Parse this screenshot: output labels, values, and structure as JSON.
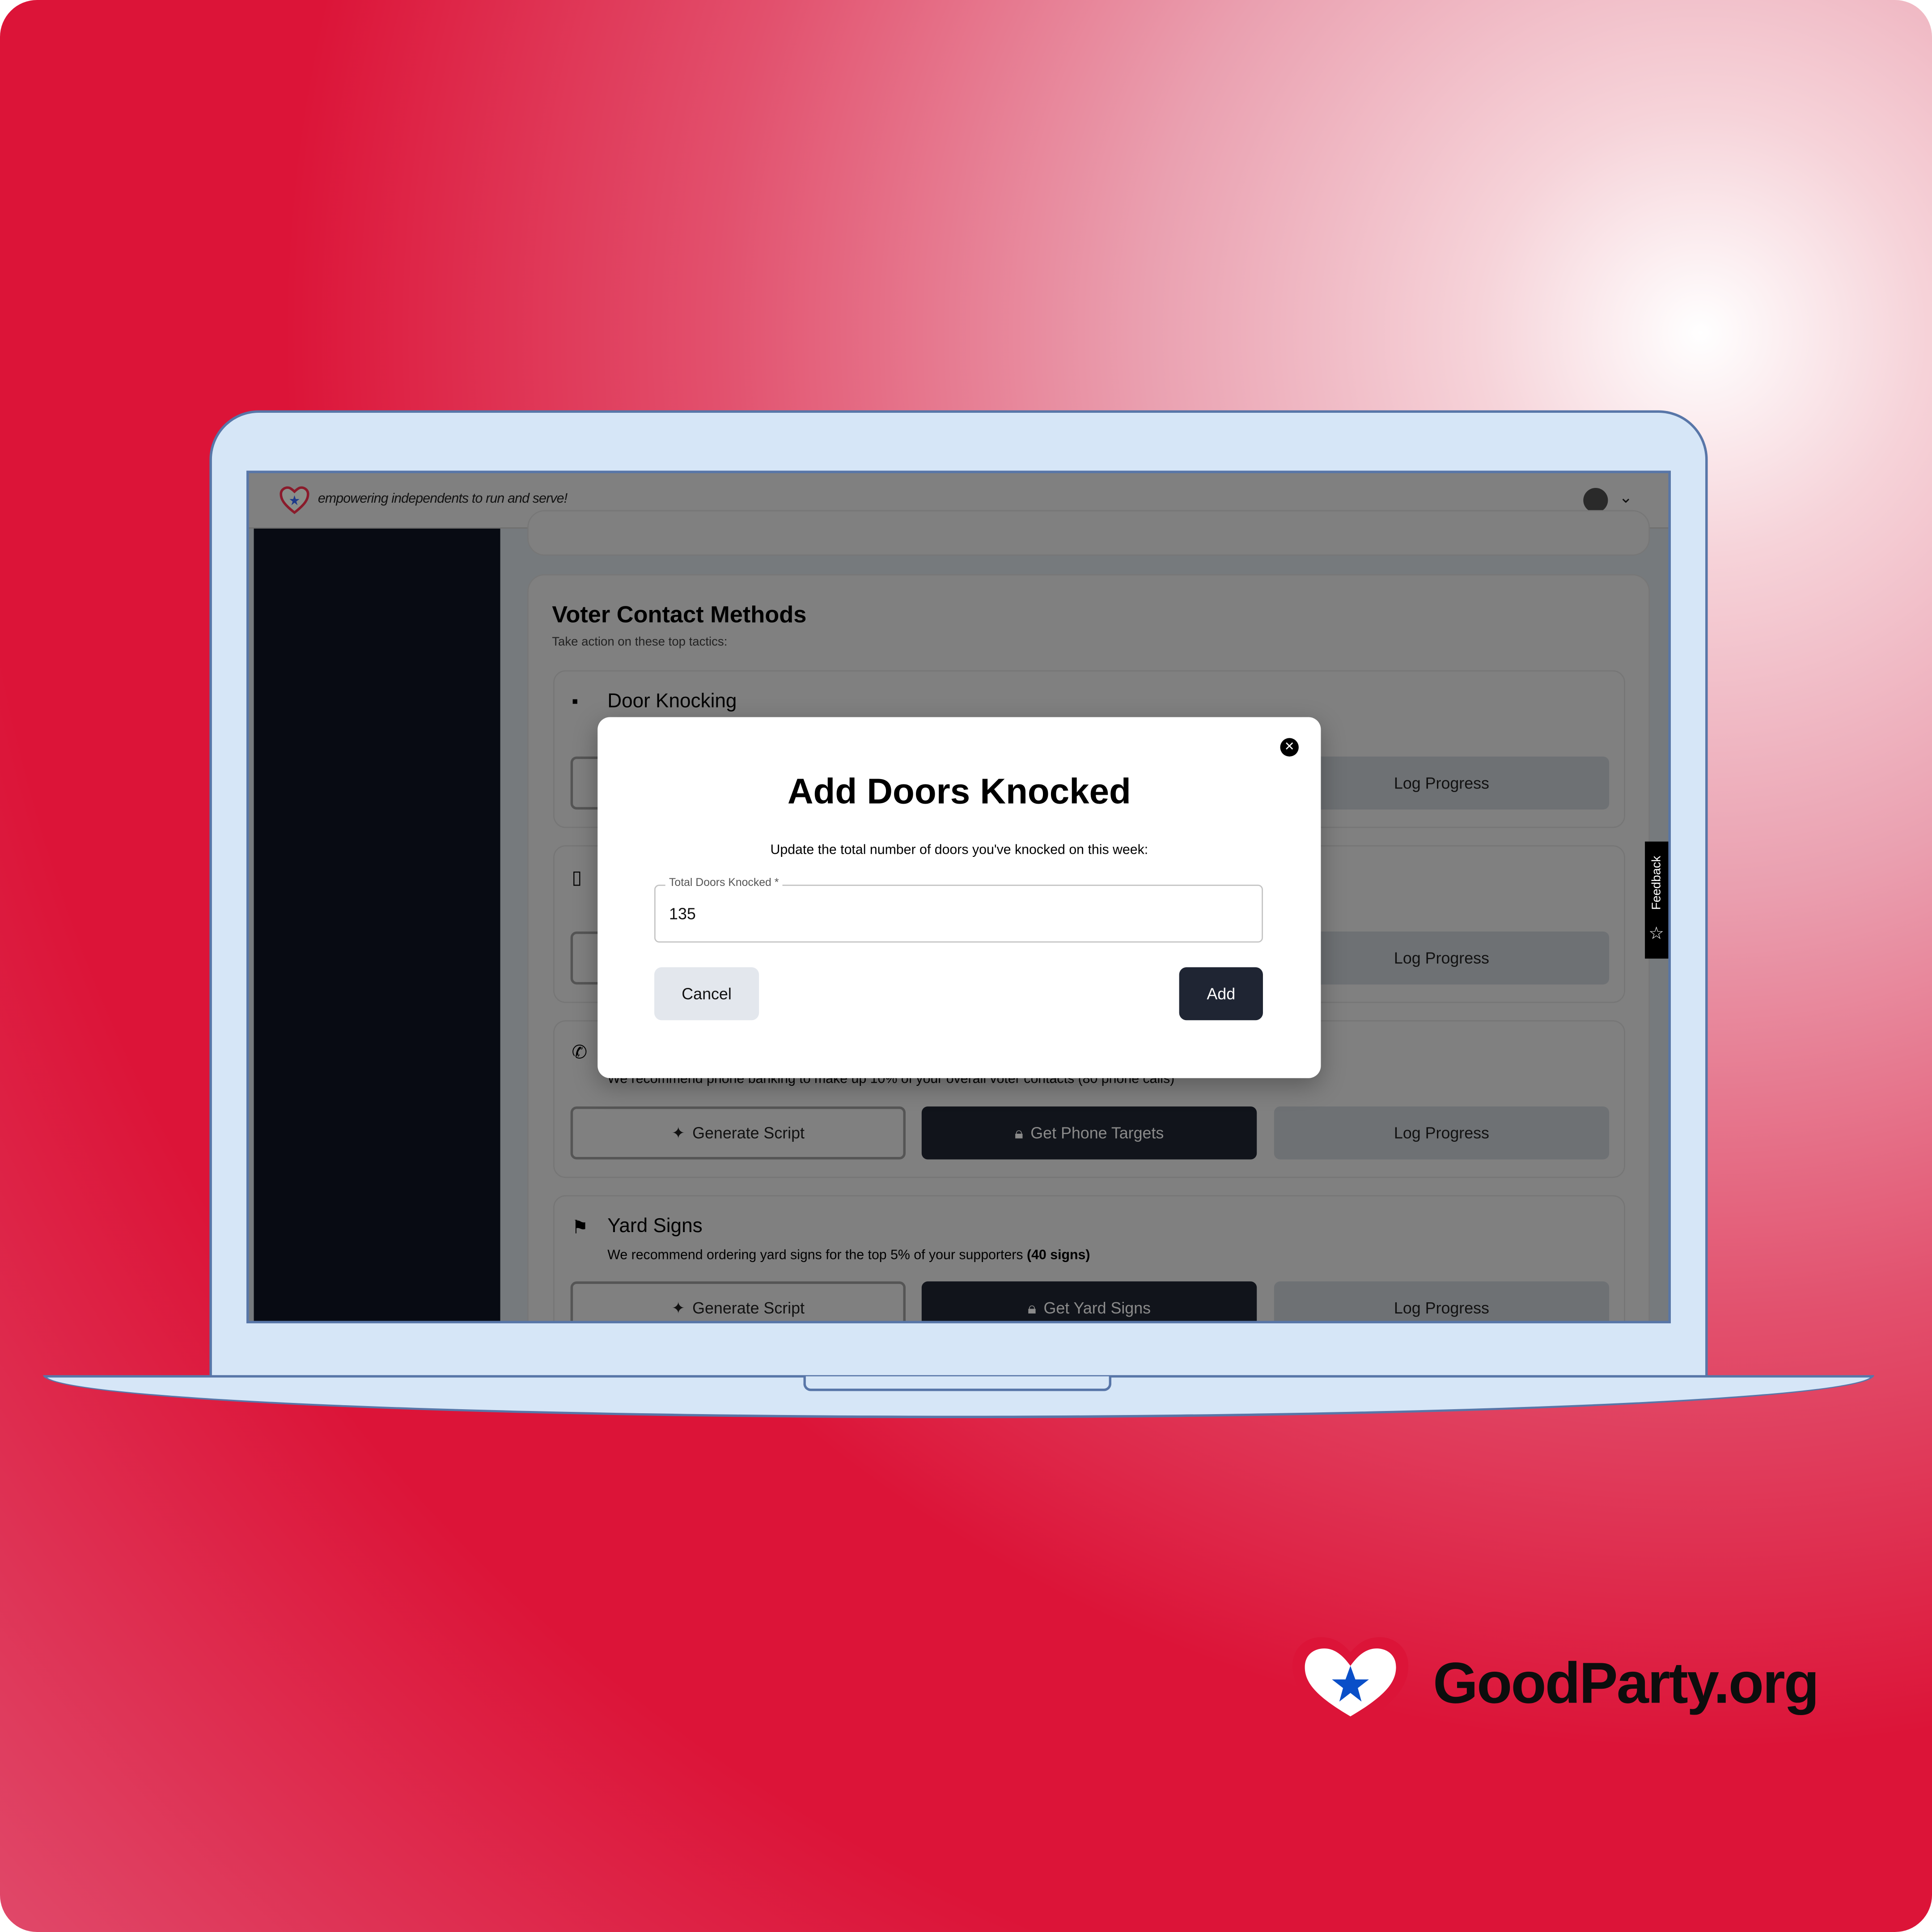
{
  "header": {
    "tagline": "empowering independents to run and serve!",
    "avatar_icon": "user-avatar",
    "menu_icon": "chevron-down-icon"
  },
  "section": {
    "title": "Voter Contact Methods",
    "subtitle": "Take action on these top tactics:"
  },
  "tactics": [
    {
      "title": "Door Knocking",
      "icon": "door-icon",
      "log": "Log Progress"
    },
    {
      "icon": "mobile-phone-icon",
      "log": "Log Progress"
    },
    {
      "icon": "phone-icon",
      "description": "We recommend phone banking to make up 10% of your overall voter contacts (80 phone calls)",
      "generate": "Generate Script",
      "primary": "Get Phone Targets",
      "log": "Log Progress"
    },
    {
      "title": "Yard Signs",
      "icon": "signpost-icon",
      "description": "We recommend ordering yard signs for the top 5% of your supporters",
      "description_bold": "(40 signs)",
      "generate": "Generate Script",
      "primary": "Get Yard Signs",
      "log": "Log Progress"
    }
  ],
  "feedback": "Feedback",
  "modal": {
    "title": "Add Doors Knocked",
    "description": "Update the total number of doors you've knocked on this week:",
    "field_label": "Total Doors Knocked *",
    "field_value": "135",
    "cancel": "Cancel",
    "add": "Add"
  },
  "brand": {
    "name": "GoodParty.org",
    "colors": {
      "red": "#dc1438",
      "blue": "#0a4fc8",
      "laptop": "#d6e6f7",
      "outline": "#5876a8"
    }
  }
}
